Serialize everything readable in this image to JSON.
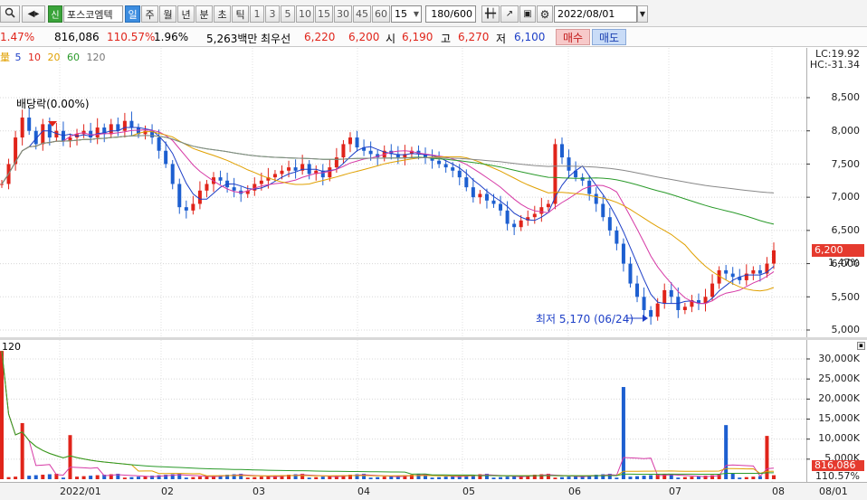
{
  "toolbar": {
    "search_icon": "search-icon",
    "prev_icon": "speaker-prev-icon",
    "sin_label": "신",
    "stock_name": "포스코엠텍",
    "periods": [
      "일",
      "주",
      "월",
      "년",
      "분",
      "초",
      "틱"
    ],
    "active_period": "일",
    "minute_units": [
      "1",
      "3",
      "5",
      "10",
      "15",
      "30",
      "45",
      "60"
    ],
    "tick_unit": "15",
    "bar_count": "180/600",
    "date": "2022/08/01"
  },
  "quote": {
    "change_pct": "1.47%",
    "volume": "816,086",
    "volume_ratio": "110.57%",
    "turnover_rate": "1.96%",
    "trade_amount": "5,263백만",
    "best_label": "최우선",
    "ask": "6,220",
    "bid": "6,200",
    "open_label": "시",
    "open": "6,190",
    "high_label": "고",
    "high": "6,270",
    "low_label": "저",
    "low": "6,100",
    "buy_label": "매수",
    "sell_label": "매도"
  },
  "ma_legend": {
    "prefix": "量",
    "items": [
      {
        "label": "5",
        "color": "#1d3fc7"
      },
      {
        "label": "10",
        "color": "#e0241a"
      },
      {
        "label": "20",
        "color": "#e0a000"
      },
      {
        "label": "60",
        "color": "#2a9a2a"
      },
      {
        "label": "120",
        "color": "#777777"
      }
    ]
  },
  "price_axis": {
    "labels": [
      "8,500",
      "8,000",
      "7,500",
      "7,000",
      "6,500",
      "6,000",
      "5,500",
      "5,000"
    ],
    "lc": "LC:19.92",
    "hc": "HC:-31.34",
    "current": "6,200",
    "current_pct": "1.47%"
  },
  "volume_axis": {
    "title": "120",
    "labels": [
      "30,000K",
      "25,000K",
      "20,000K",
      "15,000K",
      "10,000K",
      "5,000K"
    ],
    "current_volume": "816,086",
    "current_ratio": "110.57%"
  },
  "annotations": {
    "dividend": "배당락(0.00%)",
    "low": "최저 5,170 (06/24)"
  },
  "date_axis": {
    "labels": [
      "2022/01",
      "02",
      "03",
      "04",
      "05",
      "06",
      "07",
      "08",
      "08/01"
    ]
  },
  "chart_data": {
    "type": "candlestick",
    "x_range": [
      "2021/12",
      "2022/08/01"
    ],
    "price_ylim": [
      5000,
      9000
    ],
    "volume_ylim": [
      0,
      32000000
    ],
    "last_close": 6200,
    "period_low": {
      "value": 5170,
      "date": "06/24"
    },
    "ma_periods": [
      5,
      10,
      20,
      60,
      120
    ]
  }
}
